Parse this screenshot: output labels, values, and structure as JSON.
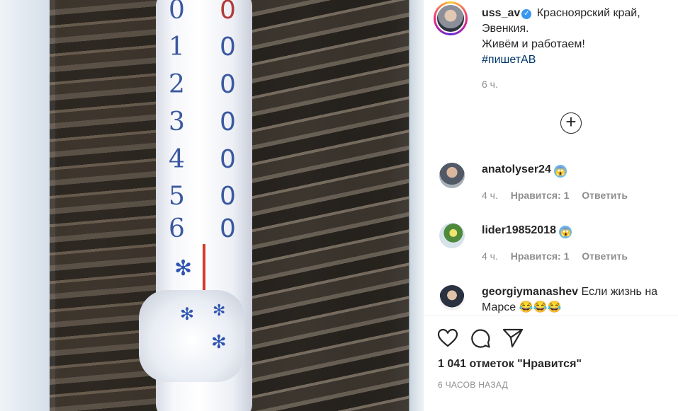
{
  "photo": {
    "thermometer_numbers": [
      "0",
      "1",
      "2",
      "3",
      "4",
      "5",
      "6"
    ],
    "thermometer_right_numbers": [
      "0",
      "0",
      "0",
      "0",
      "0",
      "0",
      "0"
    ]
  },
  "post": {
    "username": "uss_av",
    "caption_line1": "Красноярский край,",
    "caption_line2": "Эвенкия.",
    "caption_line3": "Живём и работаем!",
    "hashtag": "#пишетАВ",
    "time": "6 ч.",
    "load_more_icon": "plus-circle-icon"
  },
  "comments": [
    {
      "username": "anatolyser24",
      "text": "",
      "emoji": "😱",
      "time": "4 ч.",
      "likes": "Нравится: 1",
      "reply": "Ответить"
    },
    {
      "username": "lider19852018",
      "text": "",
      "emoji": "😱",
      "time": "4 ч.",
      "likes": "Нравится: 1",
      "reply": "Ответить"
    },
    {
      "username": "georgiymanashev",
      "text": "Если жизнь на Марсе",
      "emoji": "😂😂😂"
    }
  ],
  "actions": {
    "like_icon": "heart-icon",
    "comment_icon": "comment-icon",
    "share_icon": "send-icon"
  },
  "likes_text": "1 041 отметок \"Нравится\"",
  "date_text": "6 ЧАСОВ НАЗАД",
  "colors": {
    "link": "#00376b",
    "verified": "#3897f0",
    "muted": "#8e8e8e"
  }
}
